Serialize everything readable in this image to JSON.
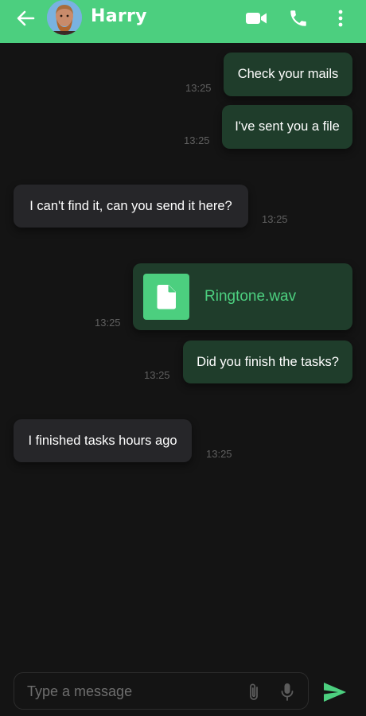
{
  "header": {
    "contact_name": "Harry",
    "accent_color": "#4ccf7f",
    "icons": [
      "back-arrow-icon",
      "video-call-icon",
      "phone-icon",
      "more-vertical-icon"
    ]
  },
  "messages": [
    {
      "direction": "sent",
      "text": "Check your mails",
      "time": "13:25"
    },
    {
      "direction": "sent",
      "text": "I've sent you a file",
      "time": "13:25"
    },
    {
      "direction": "received",
      "text": "I can't find it, can you send it here?",
      "time": "13:25"
    },
    {
      "direction": "sent",
      "type": "file",
      "file_name": "Ringtone.wav",
      "icon": "file-icon",
      "time": "13:25"
    },
    {
      "direction": "sent",
      "text": "Did you finish the tasks?",
      "time": "13:25"
    },
    {
      "direction": "received",
      "text": "I finished tasks hours ago",
      "time": "13:25"
    }
  ],
  "composer": {
    "placeholder": "Type a message",
    "value": "",
    "icons": [
      "attach-icon",
      "mic-icon",
      "send-icon"
    ]
  }
}
